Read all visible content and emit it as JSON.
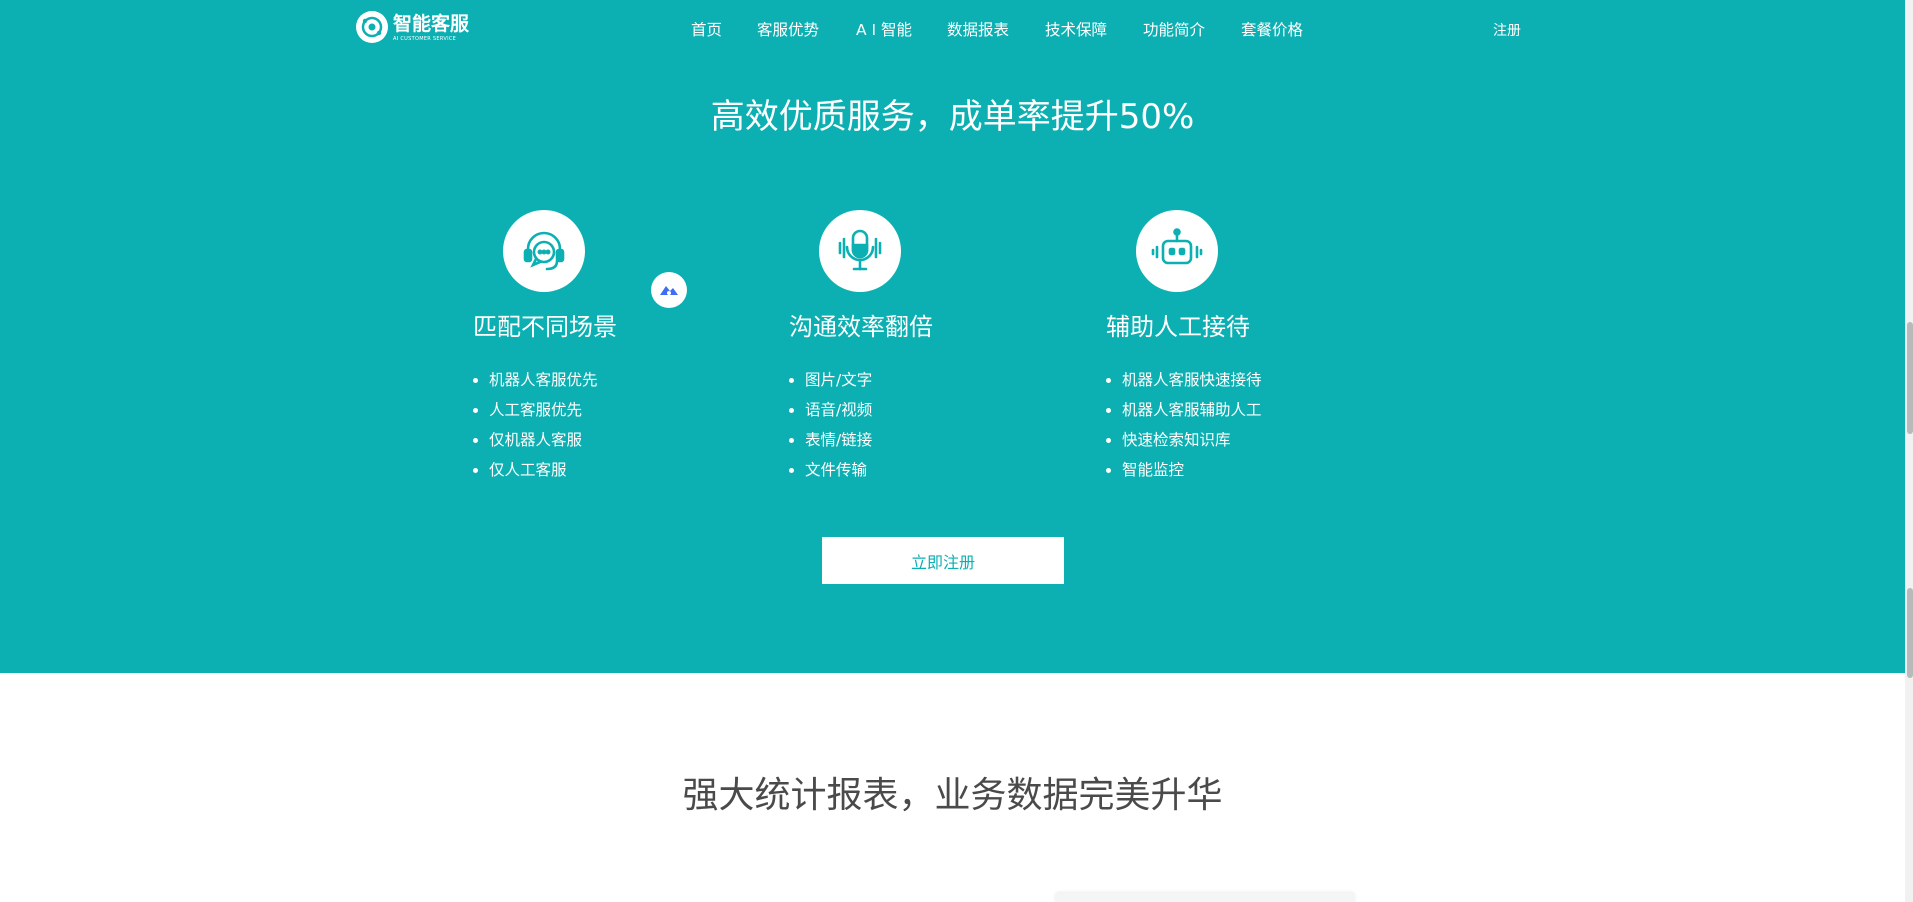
{
  "logo": {
    "name": "智能客服",
    "subtitle": "AI CUSTOMER SERVICE"
  },
  "nav": [
    {
      "label": "首页"
    },
    {
      "label": "客服优势"
    },
    {
      "label": "A I 智能"
    },
    {
      "label": "数据报表"
    },
    {
      "label": "技术保障"
    },
    {
      "label": "功能简介"
    },
    {
      "label": "套餐价格"
    }
  ],
  "header": {
    "register": "注册"
  },
  "hero": {
    "title": "高效优质服务，成单率提升50%"
  },
  "features": [
    {
      "title": "匹配不同场景",
      "icon": "headset-chat-icon",
      "items": [
        "机器人客服优先",
        "人工客服优先",
        "仅机器人客服",
        "仅人工客服"
      ]
    },
    {
      "title": "沟通效率翻倍",
      "icon": "microphone-icon",
      "items": [
        "图片/文字",
        "语音/视频",
        "表情/链接",
        "文件传输"
      ]
    },
    {
      "title": "辅助人工接待",
      "icon": "robot-icon",
      "items": [
        "机器人客服快速接待",
        "机器人客服辅助人工",
        "快速检索知识库",
        "智能监控"
      ]
    }
  ],
  "cta": {
    "label": "立即注册"
  },
  "stats_section": {
    "title": "强大统计报表，业务数据完美升华"
  },
  "colors": {
    "brand": "#0cb0b3",
    "text_dark": "#4a4a4a",
    "white": "#ffffff"
  }
}
